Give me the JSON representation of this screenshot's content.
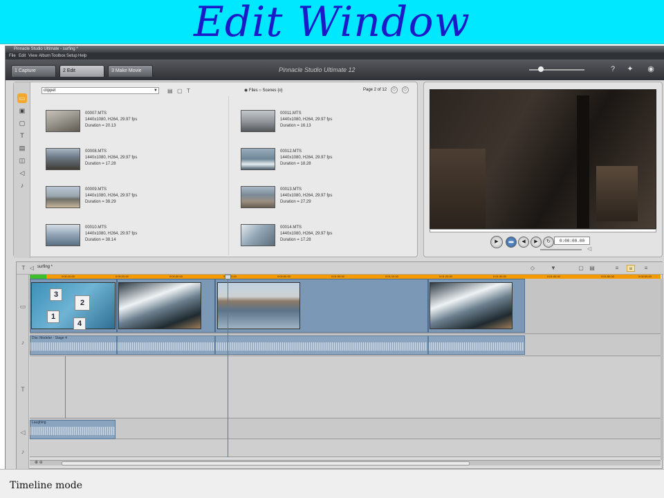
{
  "slide": {
    "title": "Edit Window"
  },
  "window": {
    "title": "Pinnacle Studio Ultimate - surfing *"
  },
  "menu": [
    "File",
    "Edit",
    "View",
    "Album",
    "Toolbox",
    "Setup",
    "Help"
  ],
  "tabs": [
    {
      "label": "1 Capture"
    },
    {
      "label": "2 Edit"
    },
    {
      "label": "3 Make Movie"
    }
  ],
  "product_name": "Pinnacle Studio Ultimate 12",
  "icons": {
    "help": "question-icon",
    "bulb": "lightbulb-icon",
    "disc": "disc-icon"
  },
  "album": {
    "project": "clippet",
    "view_options": "◉ Files  ○ Scenes  {o}",
    "page": "Page 2 of 12",
    "clips": [
      {
        "name": "00007.MTS",
        "format": "1440x1080, H264, 29.97 fps",
        "duration": "Duration = 20.13"
      },
      {
        "name": "00008.MTS",
        "format": "1440x1080, H264, 29.97 fps",
        "duration": "Duration = 17.28"
      },
      {
        "name": "00009.MTS",
        "format": "1440x1080, H264, 29.97 fps",
        "duration": "Duration = 38.29"
      },
      {
        "name": "00010.MTS",
        "format": "1440x1080, H264, 29.97 fps",
        "duration": "Duration = 38.14"
      },
      {
        "name": "00011.MTS",
        "format": "1440x1080, H264, 29.97 fps",
        "duration": "Duration = 16.13"
      },
      {
        "name": "00012.MTS",
        "format": "1440x1080, H264, 29.97 fps",
        "duration": "Duration = 18.28"
      },
      {
        "name": "00013.MTS",
        "format": "1440x1080, H264, 29.97 fps",
        "duration": "Duration = 27.29"
      },
      {
        "name": "00014.MTS",
        "format": "1440x1080, H264, 29.97 fps",
        "duration": "Duration = 17.28"
      }
    ]
  },
  "preview": {
    "timecode": "0:00:00.00"
  },
  "timeline": {
    "project_name": "surfing *",
    "ruler_labels": [
      "0:00:10.00",
      "0:00:20.00",
      "0:00:30.00",
      "0:00:40.00",
      "0:00:50.00",
      "0:01:00.00",
      "0:01:10.00",
      "0:01:20.00",
      "0:01:30.00",
      "0:01:40.00",
      "0:01:50.00",
      "0:02:00.00"
    ],
    "audio_clip_label": "Disc Modeler - Stage 4",
    "music_clip_label": "Laughing",
    "menu_numbers": [
      "3",
      "2",
      "1",
      "4"
    ]
  },
  "status": {
    "text": "Timeline mode"
  }
}
